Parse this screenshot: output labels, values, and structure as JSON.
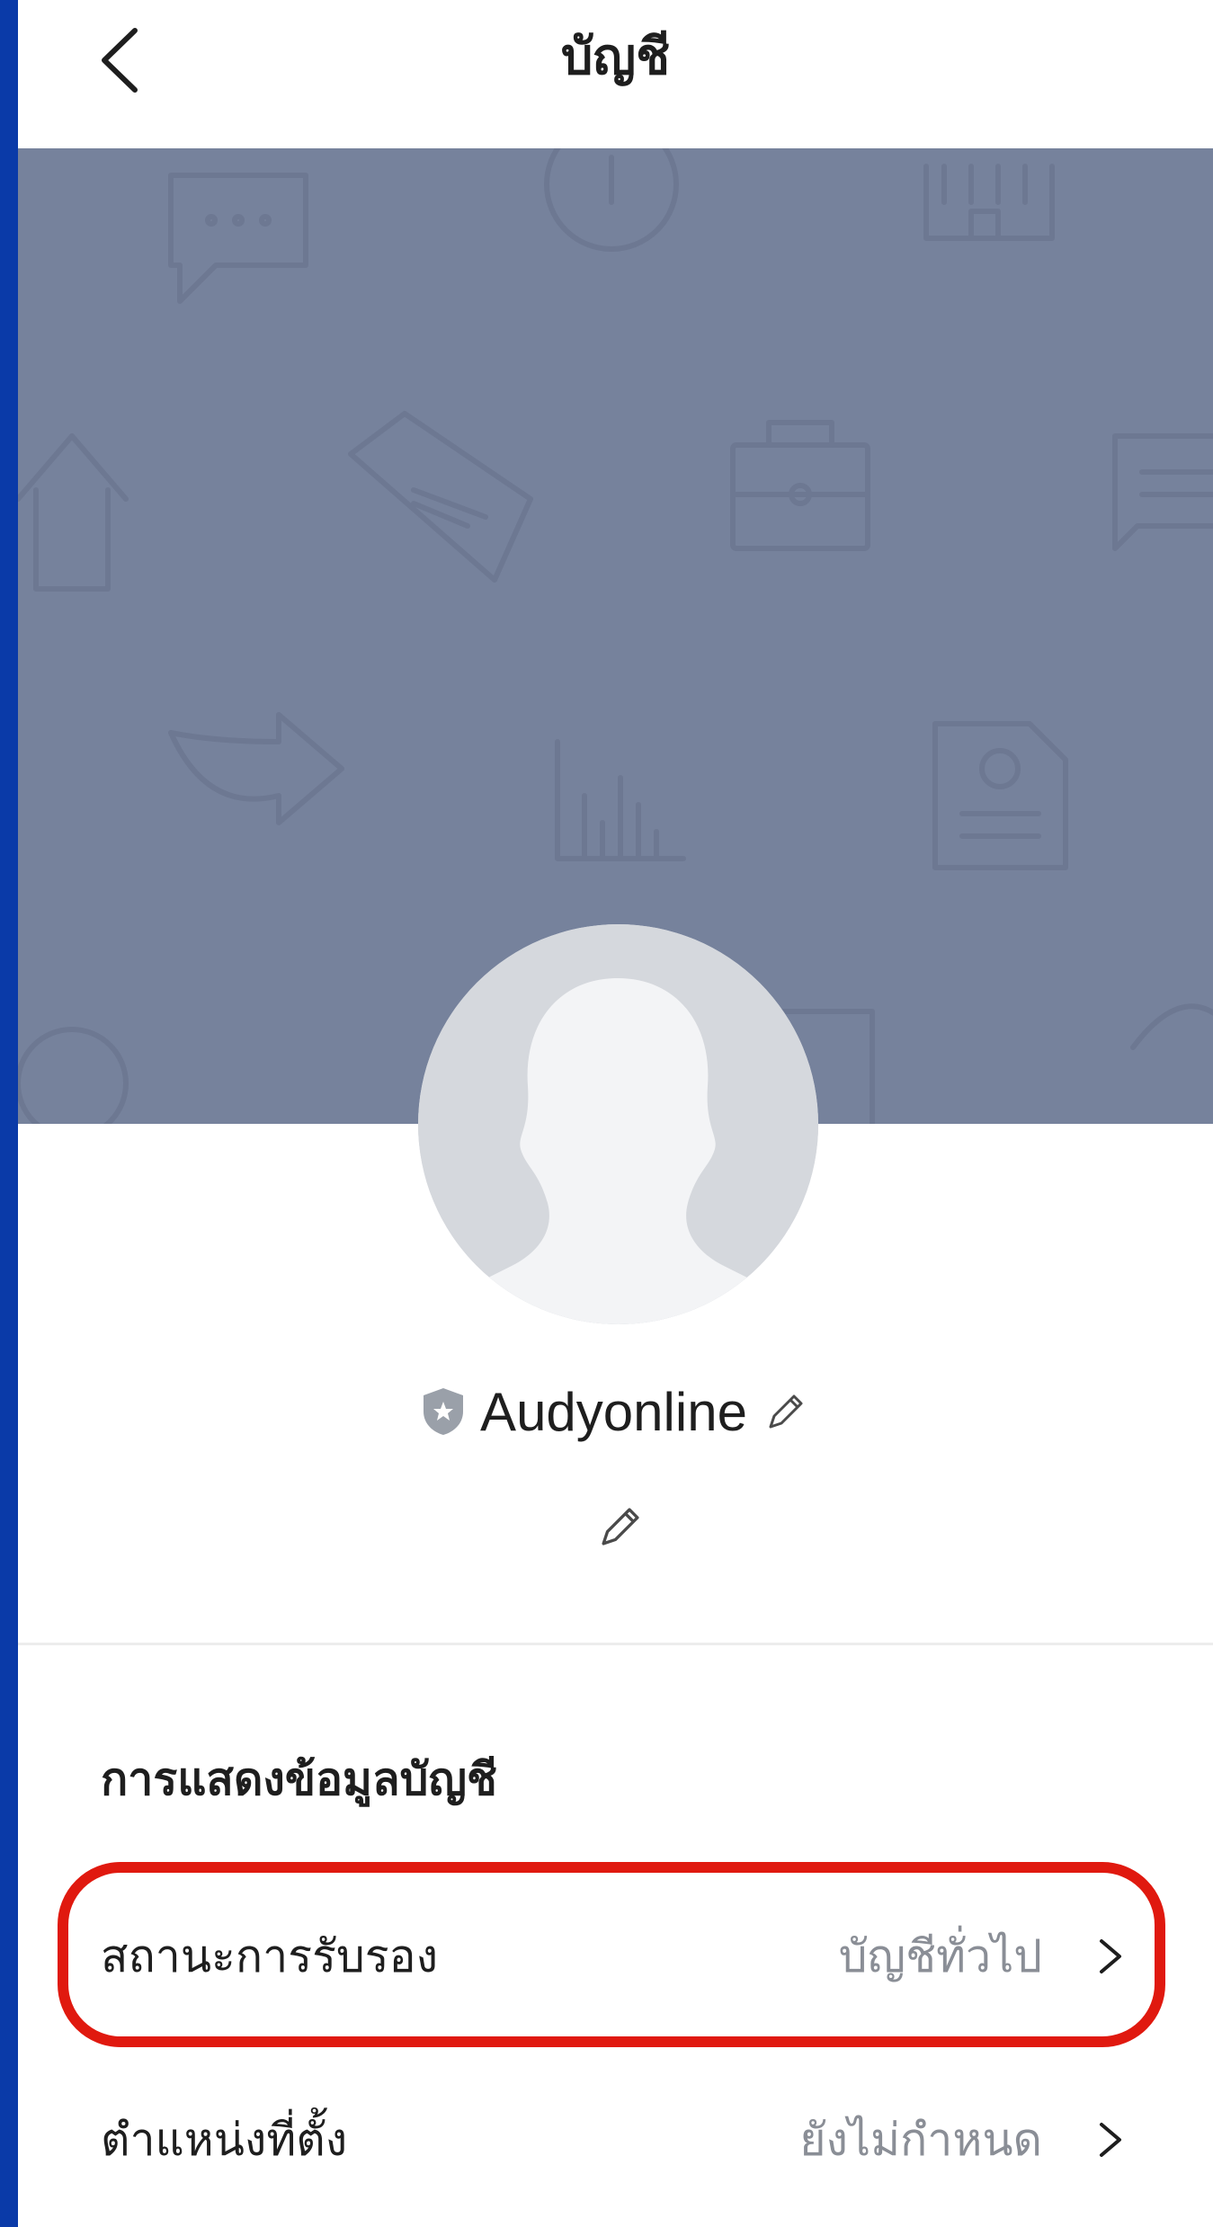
{
  "header": {
    "title": "บัญชี",
    "back_icon": "chevron-left-icon"
  },
  "profile": {
    "cover_background": "#76829c",
    "name": "Audyonline",
    "badge_icon": "shield-badge-icon",
    "name_edit_icon": "pencil-icon",
    "status_edit_icon": "pencil-icon"
  },
  "section": {
    "title": "การแสดงข้อมูลบัญชี",
    "rows": [
      {
        "label": "สถานะการรับรอง",
        "value": "บัญชีทั่วไป",
        "highlighted": true
      },
      {
        "label": "ตำแหน่งที่ตั้ง",
        "value": "ยังไม่กำหนด",
        "highlighted": false
      }
    ]
  },
  "colors": {
    "accent_highlight": "#e0190f",
    "left_strip": "#0a3aa8",
    "secondary_text": "#8a8e96"
  }
}
